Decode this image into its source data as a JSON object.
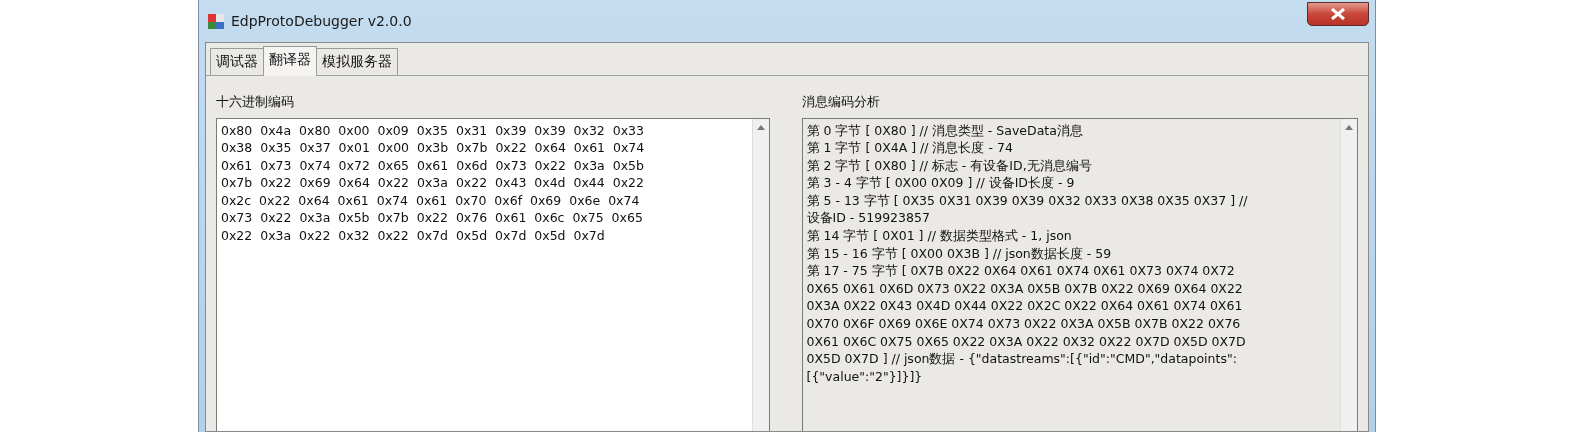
{
  "window": {
    "title": "EdpProtoDebugger v2.0.0"
  },
  "tabs": [
    {
      "label": "调试器",
      "selected": false
    },
    {
      "label": "翻译器",
      "selected": true
    },
    {
      "label": "模拟服务器",
      "selected": false
    }
  ],
  "hex_panel": {
    "label": "十六进制编码",
    "rows": [
      "0x80 0x4a 0x80 0x00 0x09 0x35 0x31 0x39 0x39 0x32 0x33",
      "0x38 0x35 0x37 0x01 0x00 0x3b 0x7b 0x22 0x64 0x61 0x74",
      "0x61 0x73 0x74 0x72 0x65 0x61 0x6d 0x73 0x22 0x3a 0x5b",
      "0x7b 0x22 0x69 0x64 0x22 0x3a 0x22 0x43 0x4d 0x44 0x22",
      "0x2c 0x22 0x64 0x61 0x74 0x61 0x70 0x6f 0x69 0x6e 0x74",
      "0x73 0x22 0x3a 0x5b 0x7b 0x22 0x76 0x61 0x6c 0x75 0x65",
      "0x22 0x3a 0x22 0x32 0x22 0x7d 0x5d 0x7d 0x5d 0x7d"
    ]
  },
  "analysis_panel": {
    "label": "消息编码分析",
    "lines": [
      "第 0 字节 [ 0X80 ] // 消息类型 - SaveData消息",
      "第 1 字节 [ 0X4A ] // 消息长度 - 74",
      "第 2 字节 [ 0X80 ] // 标志 - 有设备ID,无消息编号",
      "第 3 - 4 字节 [ 0X00 0X09 ] // 设备ID长度 - 9",
      "第 5 - 13 字节 [ 0X35 0X31 0X39 0X39 0X32 0X33 0X38 0X35 0X37 ] //",
      "设备ID - 519923857",
      "第 14 字节 [ 0X01 ] // 数据类型格式 - 1, json",
      "第 15 - 16 字节 [ 0X00 0X3B ] // json数据长度 - 59",
      "第 17 - 75 字节 [ 0X7B 0X22 0X64 0X61 0X74 0X61 0X73 0X74 0X72",
      "0X65 0X61 0X6D 0X73 0X22 0X3A 0X5B 0X7B 0X22 0X69 0X64 0X22",
      "0X3A 0X22 0X43 0X4D 0X44 0X22 0X2C 0X22 0X64 0X61 0X74 0X61",
      "0X70 0X6F 0X69 0X6E 0X74 0X73 0X22 0X3A 0X5B 0X7B 0X22 0X76",
      "0X61 0X6C 0X75 0X65 0X22 0X3A 0X22 0X32 0X22 0X7D 0X5D 0X7D",
      "0X5D 0X7D ] // json数据 - {\"datastreams\":[{\"id\":\"CMD\",\"datapoints\":",
      "[{\"value\":\"2\"}]}]}"
    ]
  }
}
